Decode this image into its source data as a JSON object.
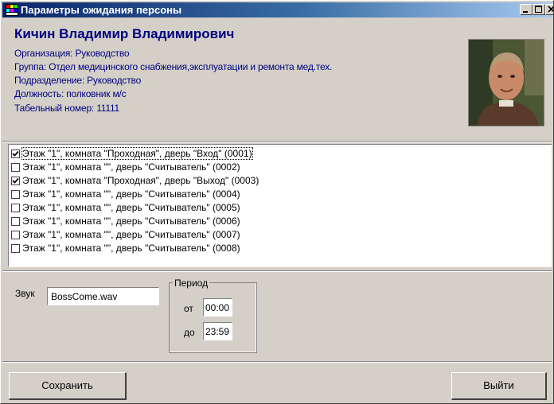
{
  "window": {
    "title": "Параметры ожидания персоны",
    "minimize_label": "_",
    "maximize_label": "□",
    "close_label": "×"
  },
  "person": {
    "name": "Кичин Владимир Владимирович",
    "organization": "Организация: Руководство",
    "group": "Группа: Отдел медицинского снабжения,эксплуатации и ремонта мед.тех.",
    "division": "Подразделение: Руководство",
    "position": "Должность: полковник м/с",
    "tab_number": "Табельный номер: 11111"
  },
  "doors": [
    {
      "label": "Этаж \"1\", комната \"Проходная\", дверь \"Вход\" (0001)",
      "checked": true,
      "focused": true
    },
    {
      "label": "Этаж \"1\", комната \"\", дверь \"Считыватель\" (0002)",
      "checked": false,
      "focused": false
    },
    {
      "label": "Этаж \"1\", комната \"Проходная\", дверь \"Выход\" (0003)",
      "checked": true,
      "focused": false
    },
    {
      "label": "Этаж \"1\", комната \"\", дверь \"Считыватель\" (0004)",
      "checked": false,
      "focused": false
    },
    {
      "label": "Этаж \"1\", комната \"\", дверь \"Считыватель\" (0005)",
      "checked": false,
      "focused": false
    },
    {
      "label": "Этаж \"1\", комната \"\", дверь \"Считыватель\" (0006)",
      "checked": false,
      "focused": false
    },
    {
      "label": "Этаж \"1\", комната \"\", дверь \"Считыватель\" (0007)",
      "checked": false,
      "focused": false
    },
    {
      "label": "Этаж \"1\", комната \"\", дверь \"Считыватель\" (0008)",
      "checked": false,
      "focused": false
    }
  ],
  "sound": {
    "label": "Звук",
    "value": "BossCome.wav"
  },
  "period": {
    "legend": "Период",
    "from_label": "от",
    "from_value": "00:00",
    "to_label": "до",
    "to_value": "23:59"
  },
  "buttons": {
    "save": "Сохранить",
    "exit": "Выйти"
  },
  "colors": {
    "accent_text": "#000080",
    "titlebar_start": "#0a246a",
    "titlebar_end": "#a6caf0",
    "face": "#d4d0c8"
  }
}
